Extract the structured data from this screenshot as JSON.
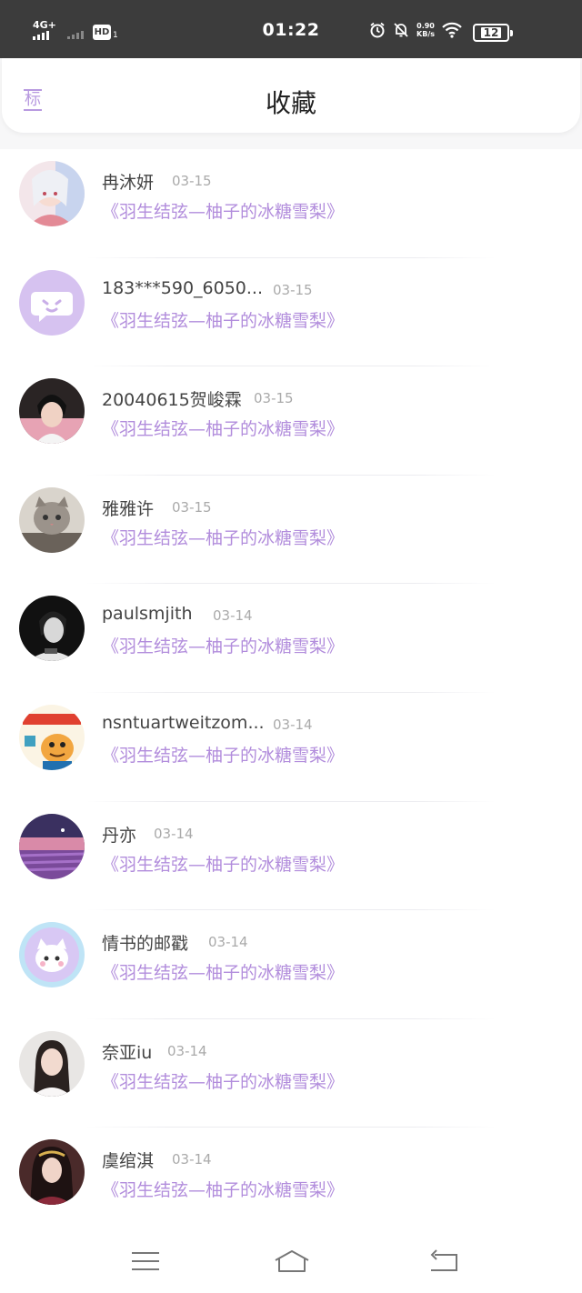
{
  "status_bar": {
    "network_label": "4G+",
    "hd_badge": "HD",
    "hd_sub": "1",
    "time": "01:22",
    "net_speed_value": "0.90",
    "net_speed_unit": "KB/s",
    "battery": "12"
  },
  "header": {
    "tab_label": "标",
    "title": "收藏"
  },
  "favorites": [
    {
      "name": "冉沐妍",
      "date": "03-15",
      "title": "《羽生结弦—柚子的冰糖雪梨》",
      "avatar": "anime-girl"
    },
    {
      "name": "183***590_6050...",
      "date": "03-15",
      "title": "《羽生结弦—柚子的冰糖雪梨》",
      "avatar": "default-chat"
    },
    {
      "name": "20040615贺峻霖",
      "date": "03-15",
      "title": "《羽生结弦—柚子的冰糖雪梨》",
      "avatar": "boy-photo"
    },
    {
      "name": "雅雅许",
      "date": "03-15",
      "title": "《羽生结弦—柚子的冰糖雪梨》",
      "avatar": "cat-photo"
    },
    {
      "name": "paulsmjith",
      "date": "03-14",
      "title": "《羽生结弦—柚子的冰糖雪梨》",
      "avatar": "dark-portrait"
    },
    {
      "name": "nsntuartweitzom...",
      "date": "03-14",
      "title": "《羽生结弦—柚子的冰糖雪梨》",
      "avatar": "cartoon"
    },
    {
      "name": "丹亦",
      "date": "03-14",
      "title": "《羽生结弦—柚子的冰糖雪梨》",
      "avatar": "lavender-field"
    },
    {
      "name": "情书的邮戳",
      "date": "03-14",
      "title": "《羽生结弦—柚子的冰糖雪梨》",
      "avatar": "cute-cat"
    },
    {
      "name": "奈亚iu",
      "date": "03-14",
      "title": "《羽生结弦—柚子的冰糖雪梨》",
      "avatar": "girl-photo"
    },
    {
      "name": "虞绾淇",
      "date": "03-14",
      "title": "《羽生结弦—柚子的冰糖雪梨》",
      "avatar": "costume-girl"
    }
  ],
  "nav": {
    "menu_icon": "menu-icon",
    "home_icon": "home-icon",
    "back_icon": "back-icon"
  }
}
